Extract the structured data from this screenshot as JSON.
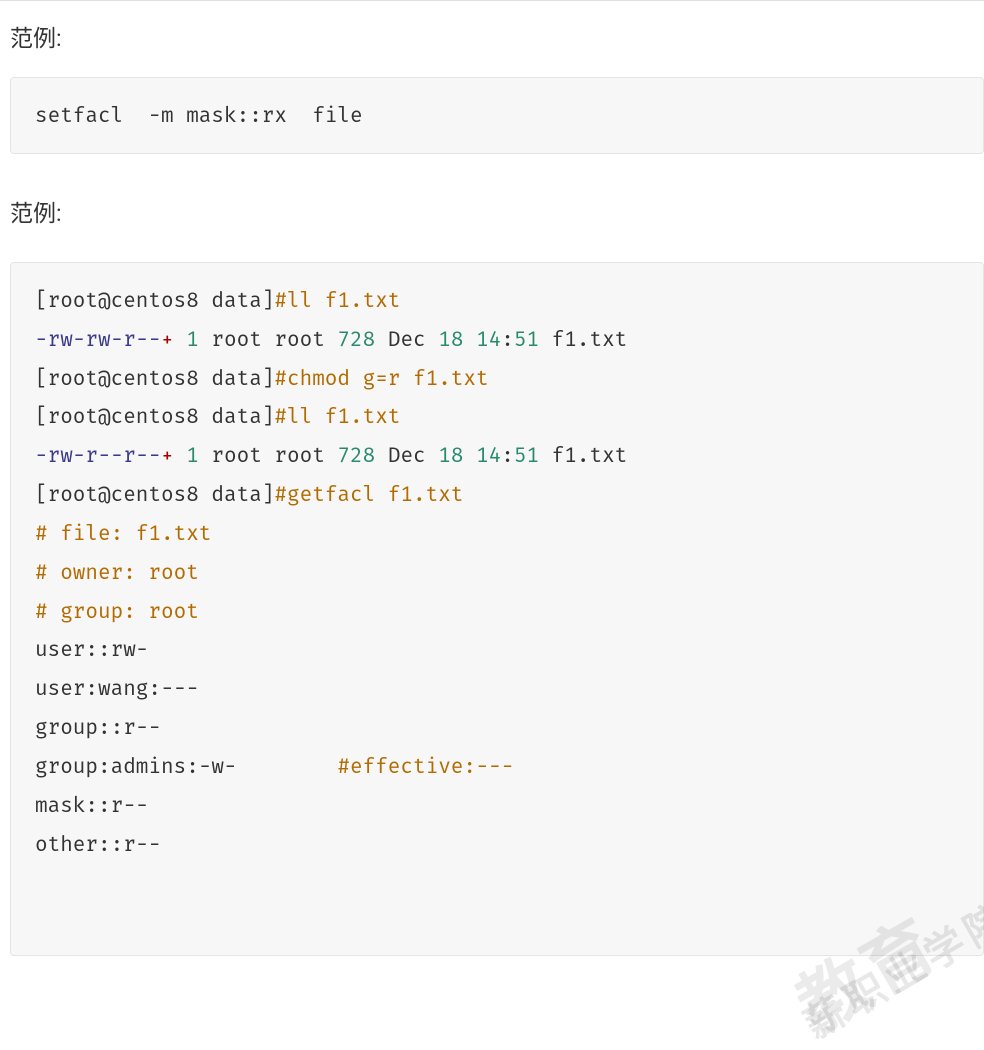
{
  "labels": {
    "example1": "范例:",
    "example2": "范例:"
  },
  "block1": {
    "line": "setfacl  -m mask::rx  file"
  },
  "block2": {
    "l1_prompt": "[root@centos8 data]",
    "l1_cmd": "#ll f1.txt",
    "l2_perm": "-rw-rw-r--",
    "l2_plus": "+",
    "l2_num": " 1",
    "l2_own": " root root ",
    "l2_size": "728",
    "l2_sp1": " ",
    "l2_month": "Dec ",
    "l2_day": "18",
    "l2_sp2": " ",
    "l2_hh": "14",
    "l2_col": ":",
    "l2_mm": "51",
    "l2_file": " f1.txt",
    "l3_prompt": "[root@centos8 data]",
    "l3_cmd": "#chmod g=r f1.txt",
    "l4_prompt": "[root@centos8 data]",
    "l4_cmd": "#ll f1.txt",
    "l5_perm": "-rw-r--r--",
    "l5_plus": "+",
    "l5_num": " 1",
    "l5_own": " root root ",
    "l5_size": "728",
    "l5_sp1": " ",
    "l5_month": "Dec ",
    "l5_day": "18",
    "l5_sp2": " ",
    "l5_hh": "14",
    "l5_col": ":",
    "l5_mm": "51",
    "l5_file": " f1.txt",
    "l6_prompt": "[root@centos8 data]",
    "l6_cmd": "#getfacl f1.txt",
    "l7": "# file: f1.txt",
    "l8": "# owner: root",
    "l9": "# group: root",
    "l10": "user::rw-",
    "l11": "user:wang:---",
    "l12": "group::r--",
    "l13a": "group:admins:-w-        ",
    "l13b": "#effective:---",
    "l14": "mask::r--",
    "l15": "other::r--"
  },
  "watermark": {
    "main": "教育",
    "side": "薪职业学院"
  }
}
